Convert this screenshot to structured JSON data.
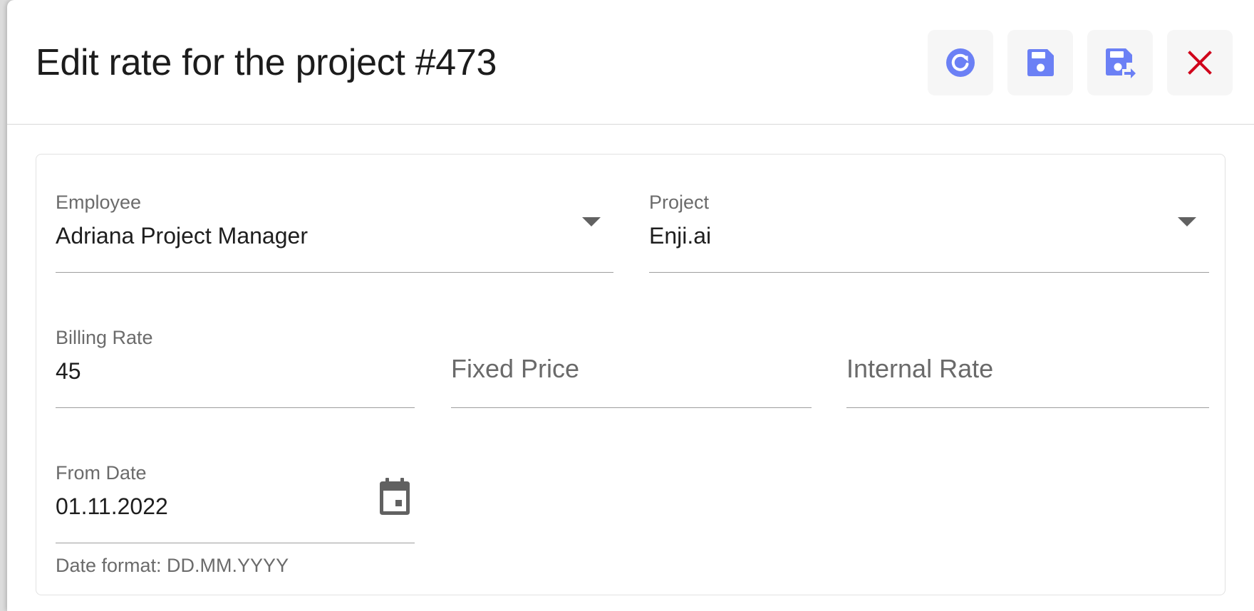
{
  "dialog": {
    "title": "Edit rate for the project #473",
    "actions": [
      {
        "name": "refresh",
        "icon": "refresh-icon"
      },
      {
        "name": "save",
        "icon": "save-icon"
      },
      {
        "name": "save-and-close",
        "icon": "save-and-close-icon"
      },
      {
        "name": "close",
        "icon": "close-icon"
      }
    ]
  },
  "form": {
    "employee": {
      "label": "Employee",
      "value": "Adriana Project Manager"
    },
    "project": {
      "label": "Project",
      "value": "Enji.ai"
    },
    "billing_rate": {
      "label": "Billing Rate",
      "value": "45"
    },
    "fixed_price": {
      "placeholder": "Fixed Price",
      "value": ""
    },
    "internal_rate": {
      "placeholder": "Internal Rate",
      "value": ""
    },
    "from_date": {
      "label": "From Date",
      "value": "01.11.2022",
      "helper": "Date format: DD.MM.YYYY"
    }
  },
  "colors": {
    "accent": "#6b80f5",
    "close": "#d0021b",
    "icon_gray": "#616161",
    "text": "#1e1e1e",
    "label": "#6b6b6b"
  }
}
